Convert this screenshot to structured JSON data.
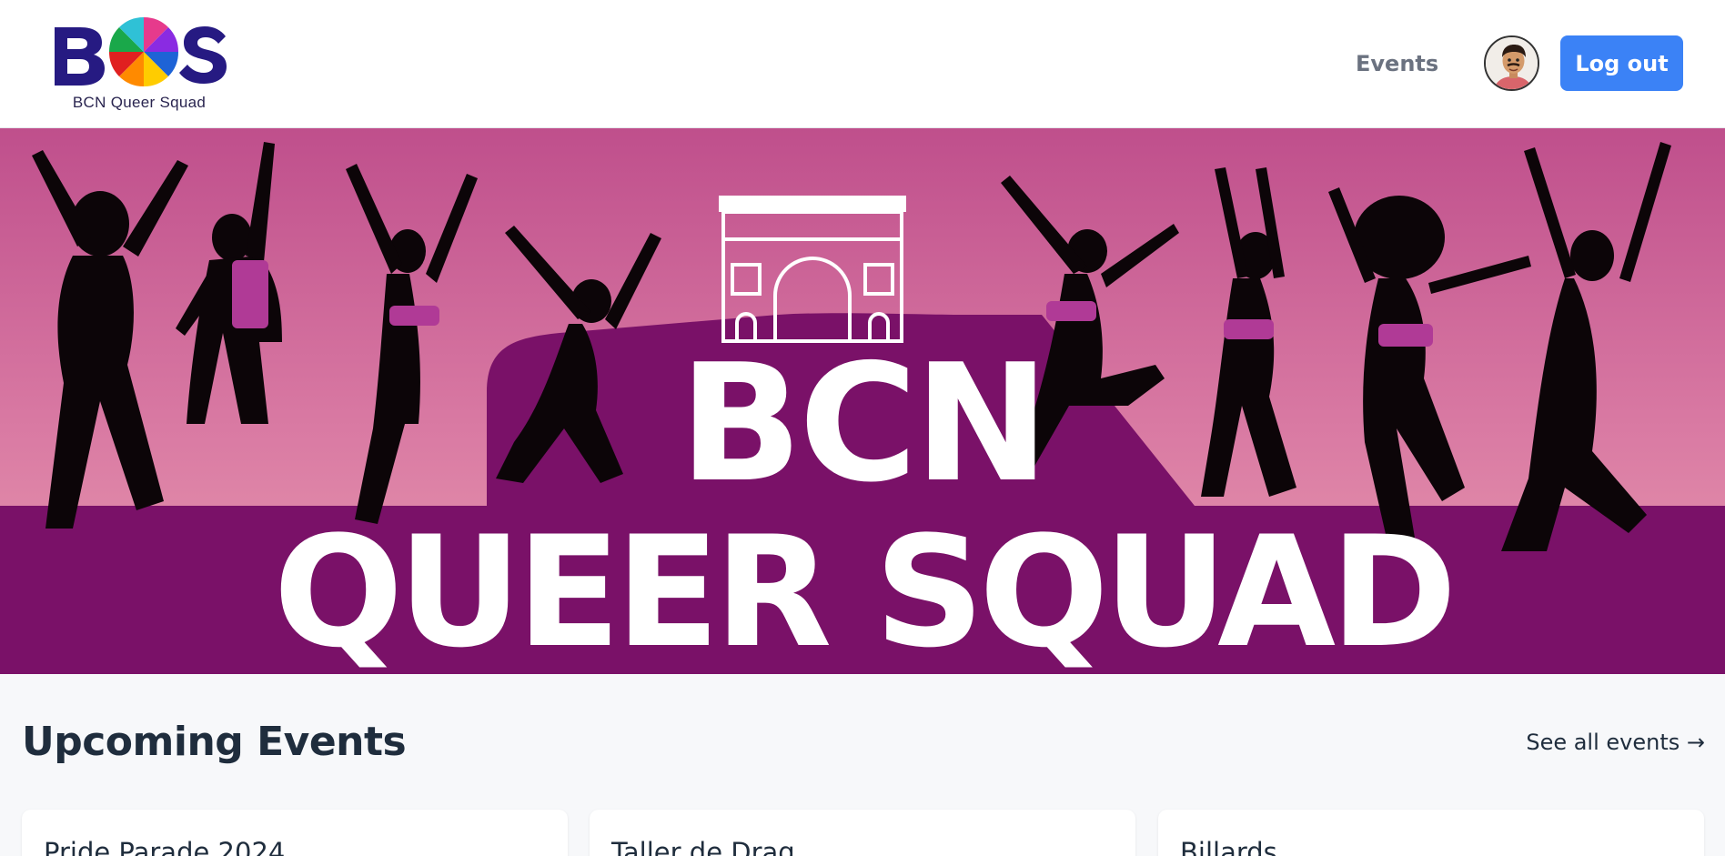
{
  "header": {
    "logo_text": "BQS",
    "logo_subtitle": "BCN Queer Squad",
    "nav_events": "Events",
    "logout_label": "Log out"
  },
  "hero": {
    "line1": "BCN",
    "line2": "QUEER SQUAD"
  },
  "upcoming": {
    "title": "Upcoming Events",
    "see_all": "See all events →",
    "events": [
      {
        "title": "Pride Parade 2024"
      },
      {
        "title": "Taller de Drag"
      },
      {
        "title": "Billards"
      }
    ]
  },
  "colors": {
    "accent": "#3b82f6",
    "hero_purple": "#7a1168",
    "hero_pink_top": "#c2558f",
    "hero_pink_bottom": "#e79aaf"
  }
}
